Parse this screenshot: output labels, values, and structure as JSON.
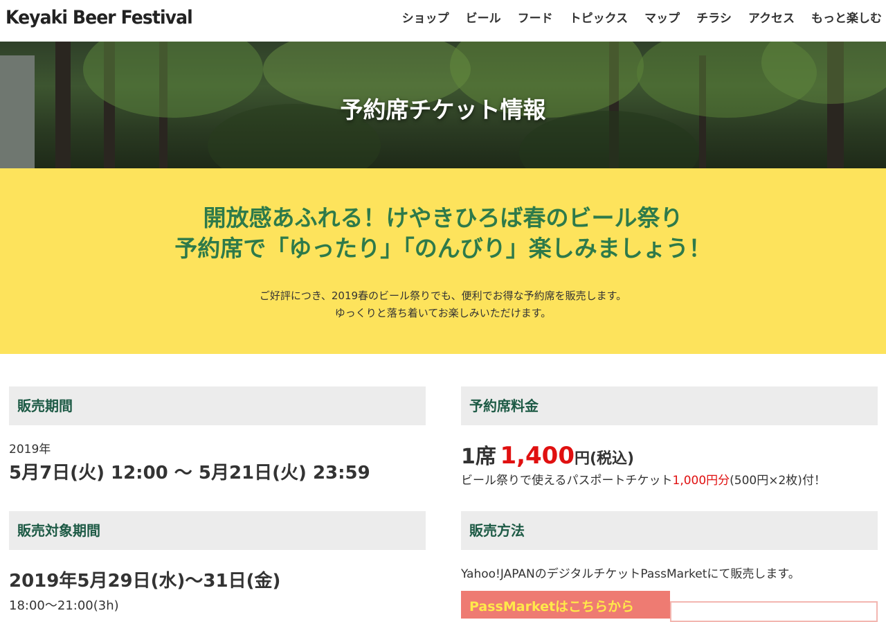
{
  "header": {
    "logo": "Keyaki Beer Festival",
    "nav": [
      "ショップ",
      "ビール",
      "フード",
      "トピックス",
      "マップ",
      "チラシ",
      "アクセス",
      "もっと楽しむ"
    ]
  },
  "hero": {
    "title": "予約席チケット情報"
  },
  "banner": {
    "headline_line1": "開放感あふれる！けやきひろば春のビール祭り",
    "headline_line2": "予約席で「ゆったり」「のんびり」楽しみましょう！",
    "intro_line1": "ご好評につき、2019春のビール祭りでも、便利でお得な予約席を販売します。",
    "intro_line2": "ゆっくりと落ち着いてお楽しみいただけます。"
  },
  "sales_period": {
    "heading": "販売期間",
    "year": "2019年",
    "date_line": "5月7日(火) 12:00 〜 5月21日(火) 23:59"
  },
  "target_period": {
    "heading": "販売対象期間",
    "date_line": "2019年5月29日(水)〜31日(金)",
    "time_line": "18:00〜21:00(3h)"
  },
  "price": {
    "heading": "予約席料金",
    "seat_prefix": "1席",
    "amount": "1,400",
    "suffix": "円(税込)",
    "note_before": "ビール祭りで使えるパスポートチケット",
    "note_red": "1,000円分",
    "note_after": "(500円×2枚)付！"
  },
  "method": {
    "heading": "販売方法",
    "text": "Yahoo!JAPANのデジタルチケットPassMarketにて販売します。",
    "button": "PassMarketはこちらから"
  },
  "colors": {
    "accent_green": "#2e7a4a",
    "banner_yellow": "#fde35c",
    "price_red": "#e01010",
    "button_bg": "#ee7b72"
  }
}
